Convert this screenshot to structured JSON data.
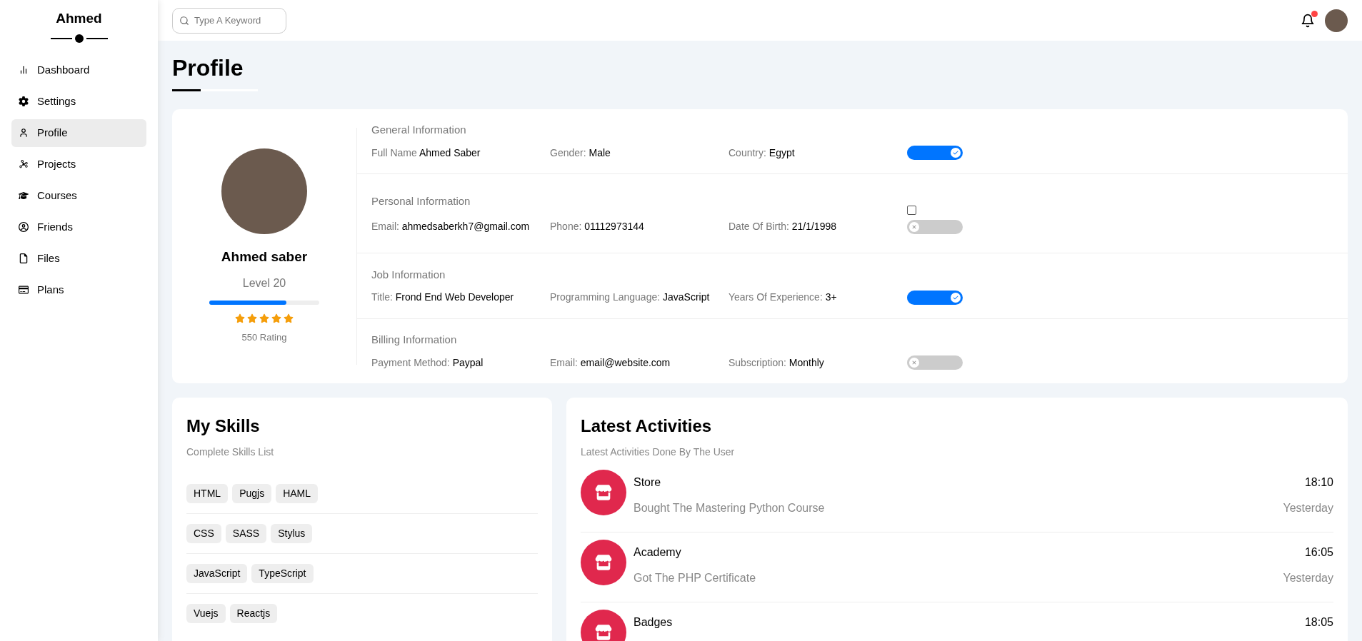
{
  "sidebar": {
    "brand": "Ahmed",
    "items": [
      {
        "label": "Dashboard",
        "selected": false
      },
      {
        "label": "Settings",
        "selected": false
      },
      {
        "label": "Profile",
        "selected": true
      },
      {
        "label": "Projects",
        "selected": false
      },
      {
        "label": "Courses",
        "selected": false
      },
      {
        "label": "Friends",
        "selected": false
      },
      {
        "label": "Files",
        "selected": false
      },
      {
        "label": "Plans",
        "selected": false
      }
    ]
  },
  "header": {
    "search": {
      "placeholder": "Type A Keyword"
    },
    "notifications": {
      "unread": true
    }
  },
  "page_title": "Profile",
  "profile": {
    "name": "Ahmed saber",
    "level_text": "Level 20",
    "level": 0.7,
    "stars": 5,
    "rating": "550 Rating"
  },
  "info_sections": [
    {
      "title": "General Information",
      "fields": [
        {
          "label": "Full Name",
          "value": "Ahmed Saber"
        },
        {
          "label": "Gender:",
          "value": "Male"
        },
        {
          "label": "Country:",
          "value": "Egypt"
        }
      ],
      "toggle_on": true
    },
    {
      "title": "Personal Information",
      "fields": [
        {
          "label": "Email:",
          "value": "ahmedsaberkh7@gmail.com"
        },
        {
          "label": "Phone:",
          "value": "01112973144"
        },
        {
          "label": "Date Of Birth:",
          "value": "21/1/1998"
        }
      ],
      "checkbox": {
        "checked": false
      },
      "toggle_on": false
    },
    {
      "title": "Job Information",
      "fields": [
        {
          "label": "Title:",
          "value": "Frond End Web Developer"
        },
        {
          "label": "Programming Language:",
          "value": "JavaScript"
        },
        {
          "label": "Years Of Experience:",
          "value": "3+"
        }
      ],
      "toggle_on": true
    },
    {
      "title": "Billing Information",
      "fields": [
        {
          "label": "Payment Method:",
          "value": "Paypal"
        },
        {
          "label": "Email:",
          "value": "email@website.com"
        },
        {
          "label": "Subscription:",
          "value": "Monthly"
        }
      ],
      "toggle_on": false
    }
  ],
  "skills": {
    "title": "My Skills",
    "subtitle": "Complete Skills List",
    "groups": [
      [
        "HTML",
        "Pugjs",
        "HAML"
      ],
      [
        "CSS",
        "SASS",
        "Stylus"
      ],
      [
        "JavaScript",
        "TypeScript"
      ],
      [
        "Vuejs",
        "Reactjs"
      ]
    ]
  },
  "activities": {
    "title": "Latest Activities",
    "subtitle": "Latest Activities Done By The User",
    "items": [
      {
        "title": "Store",
        "description": "Bought The Mastering Python Course",
        "time": "18:10",
        "day": "Yesterday"
      },
      {
        "title": "Academy",
        "description": "Got The PHP Certificate",
        "time": "16:05",
        "day": "Yesterday"
      },
      {
        "title": "Badges",
        "time": "18:05"
      }
    ]
  }
}
